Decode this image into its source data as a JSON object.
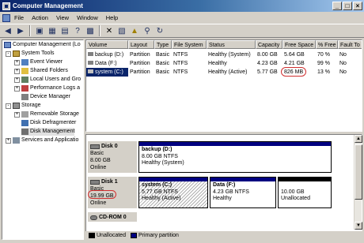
{
  "window": {
    "title": "Computer Management",
    "controls": [
      "_",
      "□",
      "×"
    ]
  },
  "menu": [
    "File",
    "Action",
    "View",
    "Window",
    "Help"
  ],
  "toolbar": [
    "back",
    "forward",
    "up",
    "show-hide",
    "properties",
    "help",
    "settings",
    "delete",
    "properties",
    "open",
    "search",
    "settings"
  ],
  "tree": [
    {
      "label": "Computer Management (Lo",
      "level": 0,
      "expander": ""
    },
    {
      "label": "System Tools",
      "level": 1,
      "expander": "-"
    },
    {
      "label": "Event Viewer",
      "level": 2,
      "expander": "+"
    },
    {
      "label": "Shared Folders",
      "level": 2,
      "expander": "+"
    },
    {
      "label": "Local Users and Gro",
      "level": 2,
      "expander": "+"
    },
    {
      "label": "Performance Logs a",
      "level": 2,
      "expander": "+"
    },
    {
      "label": "Device Manager",
      "level": 2,
      "expander": ""
    },
    {
      "label": "Storage",
      "level": 1,
      "expander": "-"
    },
    {
      "label": "Removable Storage",
      "level": 2,
      "expander": "+"
    },
    {
      "label": "Disk Defragmenter",
      "level": 2,
      "expander": ""
    },
    {
      "label": "Disk Management",
      "level": 2,
      "expander": "",
      "selected": true
    },
    {
      "label": "Services and Applicatio",
      "level": 1,
      "expander": "+"
    }
  ],
  "volume_list": {
    "headers": [
      "Volume",
      "Layout",
      "Type",
      "File System",
      "Status",
      "Capacity",
      "Free Space",
      "% Free",
      "Fault To"
    ],
    "rows": [
      [
        "backup (D:)",
        "Partition",
        "Basic",
        "NTFS",
        "Healthy (System)",
        "8.00 GB",
        "5.64 GB",
        "70 %",
        "No"
      ],
      [
        "Data (F:)",
        "Partition",
        "Basic",
        "NTFS",
        "Healthy",
        "4.23 GB",
        "4.21 GB",
        "99 %",
        "No"
      ],
      [
        "system (C:)",
        "Partition",
        "Basic",
        "NTFS",
        "Healthy (Active)",
        "5.77 GB",
        "826 MB",
        "13 %",
        "No"
      ]
    ]
  },
  "disks": [
    {
      "name": "Disk 0",
      "kind": "Basic",
      "size": "8.00 GB",
      "state": "Online",
      "partitions": [
        {
          "name": "backup  (D:)",
          "detail": "8.00 GB NTFS",
          "status": "Healthy (System)"
        }
      ]
    },
    {
      "name": "Disk 1",
      "kind": "Basic",
      "size": "19.99 GB",
      "state": "Online",
      "partitions": [
        {
          "name": "system  (C:)",
          "detail": "5.77 GB NTFS",
          "status": "Healthy (Active)"
        },
        {
          "name": "Data  (F:)",
          "detail": "4.23 GB NTFS",
          "status": "Healthy"
        },
        {
          "name": "",
          "detail": "10.00 GB",
          "status": "Unallocated"
        }
      ]
    },
    {
      "name": "CD-ROM 0"
    }
  ],
  "legend": [
    "Unallocated",
    "Primary partition"
  ],
  "colors": {
    "title_start": "#0a246a",
    "primary_partition": "#000080",
    "unallocated": "#000000",
    "highlight_ring": "#d03030",
    "selection": "#0a246a"
  }
}
